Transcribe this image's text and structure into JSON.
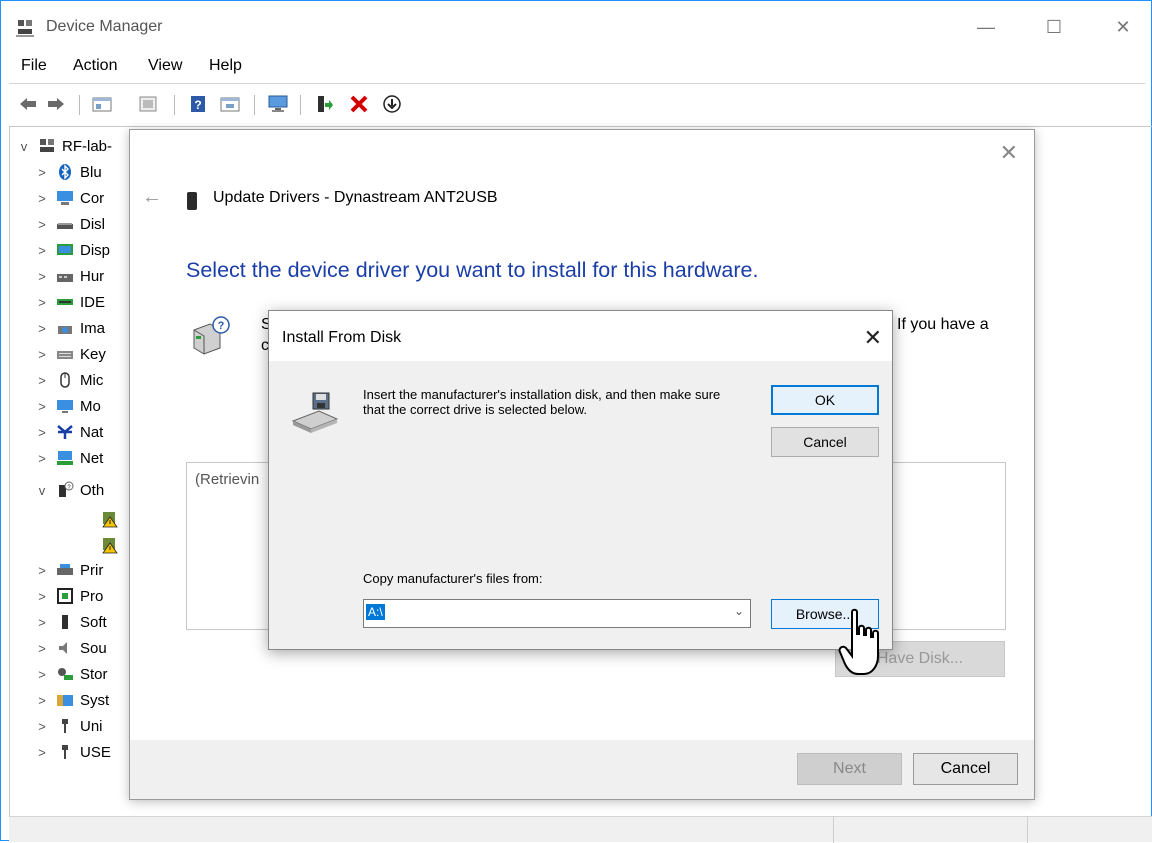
{
  "window": {
    "title": "Device Manager",
    "controls": [
      "—",
      "☐",
      "✕"
    ]
  },
  "menu": [
    "File",
    "Action",
    "View",
    "Help"
  ],
  "toolbar_icons": [
    "back-arrow-icon",
    "forward-arrow-icon",
    "properties-icon",
    "refresh-icon",
    "help-icon",
    "view-icon",
    "monitor-icon",
    "update-driver-icon",
    "uninstall-icon",
    "download-icon"
  ],
  "tree": {
    "root": "RF-lab-",
    "items": [
      {
        "label": "Blu",
        "icon": "bluetooth-icon",
        "arrow": ">"
      },
      {
        "label": "Cor",
        "icon": "computer-icon",
        "arrow": ">"
      },
      {
        "label": "Disl",
        "icon": "disk-icon",
        "arrow": ">"
      },
      {
        "label": "Disp",
        "icon": "display-icon",
        "arrow": ">"
      },
      {
        "label": "Hur",
        "icon": "hid-icon",
        "arrow": ">"
      },
      {
        "label": "IDE",
        "icon": "ide-icon",
        "arrow": ">"
      },
      {
        "label": "Ima",
        "icon": "imaging-icon",
        "arrow": ">"
      },
      {
        "label": "Key",
        "icon": "keyboard-icon",
        "arrow": ">"
      },
      {
        "label": "Mic",
        "icon": "mouse-icon",
        "arrow": ">"
      },
      {
        "label": "Mo",
        "icon": "monitor-icon",
        "arrow": ">"
      },
      {
        "label": "Nat",
        "icon": "ni-icon",
        "arrow": ">"
      },
      {
        "label": "Net",
        "icon": "network-icon",
        "arrow": ">"
      },
      {
        "label": "Oth",
        "icon": "other-devices-icon",
        "arrow": "v"
      },
      {
        "label": "",
        "icon": "warning-device-icon",
        "arrow": ""
      },
      {
        "label": "",
        "icon": "warning-device-icon",
        "arrow": ""
      },
      {
        "label": "Prir",
        "icon": "printer-icon",
        "arrow": ">"
      },
      {
        "label": "Pro",
        "icon": "processor-icon",
        "arrow": ">"
      },
      {
        "label": "Soft",
        "icon": "software-device-icon",
        "arrow": ">"
      },
      {
        "label": "Sou",
        "icon": "sound-icon",
        "arrow": ">"
      },
      {
        "label": "Stor",
        "icon": "storage-icon",
        "arrow": ">"
      },
      {
        "label": "Syst",
        "icon": "system-icon",
        "arrow": ">"
      },
      {
        "label": "Uni",
        "icon": "usb-icon",
        "arrow": ">"
      },
      {
        "label": "USE",
        "icon": "usb-icon",
        "arrow": ">"
      }
    ]
  },
  "wizard": {
    "close": "✕",
    "back": "←",
    "title": "Update Drivers - Dynastream ANT2USB",
    "heading": "Select the device driver you want to install for this hardware.",
    "instruction_start": "S",
    "instruction_start2": "c",
    "instruction_tail": "If you have a",
    "list_text": "(Retrievin",
    "have_disk": "Have Disk...",
    "next": "Next",
    "cancel": "Cancel"
  },
  "install_from_disk": {
    "title": "Install From Disk",
    "close": "✕",
    "message": "Insert the manufacturer's installation disk, and then make sure that the correct drive is selected below.",
    "ok": "OK",
    "cancel": "Cancel",
    "copy_label": "Copy manufacturer's files from:",
    "path_value": "A:\\",
    "browse": "Browse..."
  }
}
